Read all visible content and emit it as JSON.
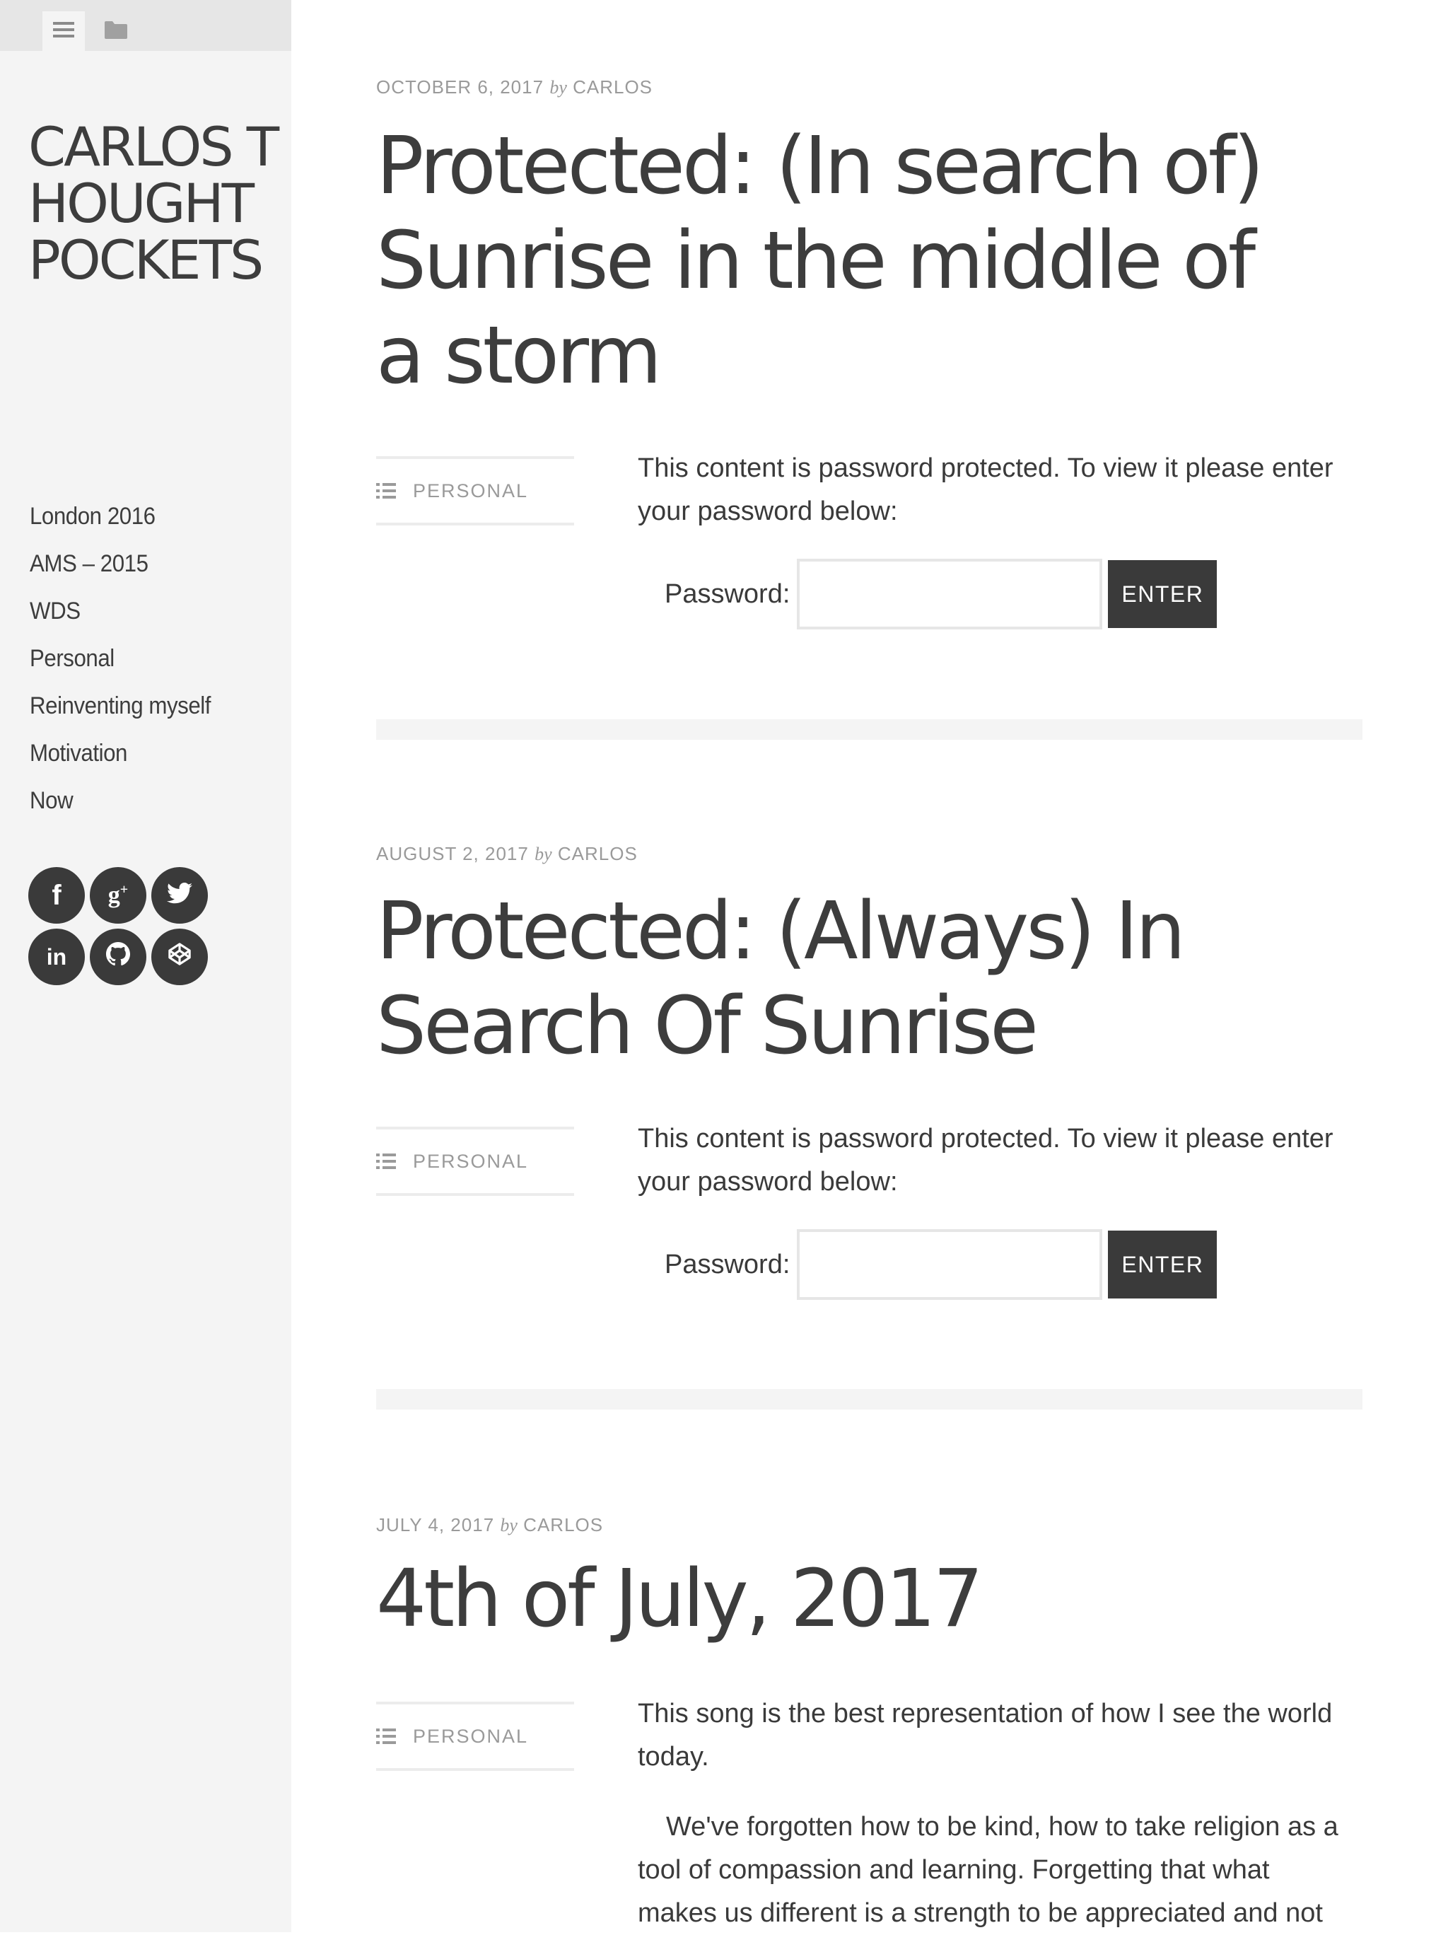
{
  "sidebar": {
    "tabs": [
      {
        "icon": "menu-icon"
      },
      {
        "icon": "folder-icon"
      }
    ],
    "site_title": "CARLOS THOUGHT POCKETS",
    "nav": [
      "London 2016",
      "AMS – 2015",
      "WDS",
      "Personal",
      "Reinventing myself",
      "Motivation",
      "Now"
    ],
    "social": [
      {
        "icon": "facebook-icon",
        "glyph": "f"
      },
      {
        "icon": "google-plus-icon",
        "glyph": "g+"
      },
      {
        "icon": "twitter-icon",
        "glyph": "🐦"
      },
      {
        "icon": "linkedin-icon",
        "glyph": "in"
      },
      {
        "icon": "github-icon",
        "glyph": "◉"
      },
      {
        "icon": "codepen-icon",
        "glyph": "⬡"
      }
    ]
  },
  "posts": [
    {
      "date": "OCTOBER 6, 2017",
      "by": "by",
      "author": "CARLOS",
      "title": "Protected: (In search of) Sunrise in the middle of a storm",
      "category": "PERSONAL",
      "body": "This content is password protected. To view it please enter your password below:",
      "password_label": "Password:",
      "enter_label": "ENTER"
    },
    {
      "date": "AUGUST 2, 2017",
      "by": "by",
      "author": "CARLOS",
      "title": "Protected: (Always) In Search Of Sunrise",
      "category": "PERSONAL",
      "body": "This content is password protected. To view it please enter your password below:",
      "password_label": "Password:",
      "enter_label": "ENTER"
    },
    {
      "date": "JULY 4, 2017",
      "by": "by",
      "author": "CARLOS",
      "title": "4th of July, 2017",
      "category": "PERSONAL",
      "body": "This song is the best representation of how I see the world today.",
      "body2": "We've forgotten how to be kind, how to take religion as a tool of compassion and learning. Forgetting that what makes us different is a strength to be appreciated and not"
    }
  ],
  "colors": {
    "sidebar_bg": "#f4f4f4",
    "topbar_bg": "#e6e6e6",
    "text": "#3d3d3d",
    "meta": "#9a9a9a",
    "button": "#3a3a3a"
  }
}
